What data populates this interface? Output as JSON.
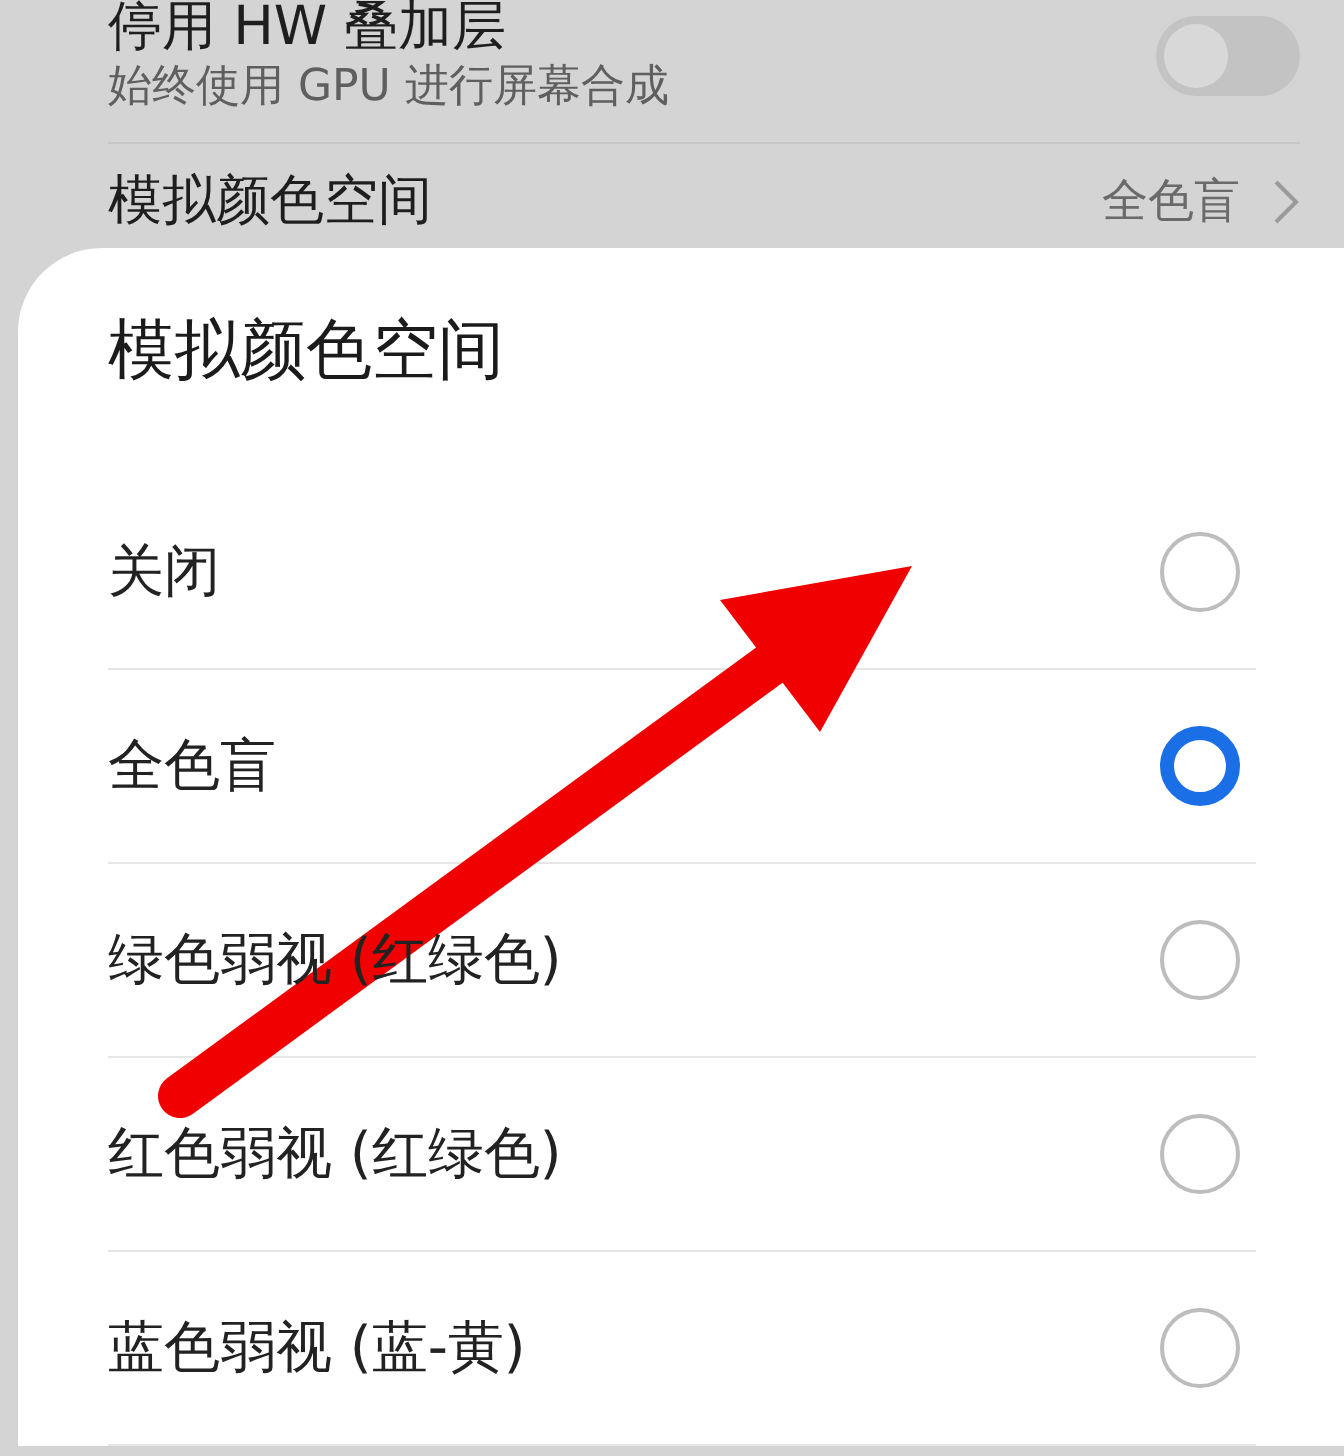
{
  "settings": [
    {
      "title": "停用 HW 叠加层",
      "subtitle": "始终使用 GPU 进行屏幕合成",
      "kind": "toggle",
      "on": false
    },
    {
      "title": "模拟颜色空间",
      "value": "全色盲",
      "kind": "link"
    }
  ],
  "dialog": {
    "title": "模拟颜色空间",
    "options": [
      {
        "label": "关闭",
        "selected": false
      },
      {
        "label": "全色盲",
        "selected": true
      },
      {
        "label": "绿色弱视 (红绿色)",
        "selected": false
      },
      {
        "label": "红色弱视 (红绿色)",
        "selected": false
      },
      {
        "label": "蓝色弱视 (蓝-黄)",
        "selected": false
      }
    ]
  }
}
